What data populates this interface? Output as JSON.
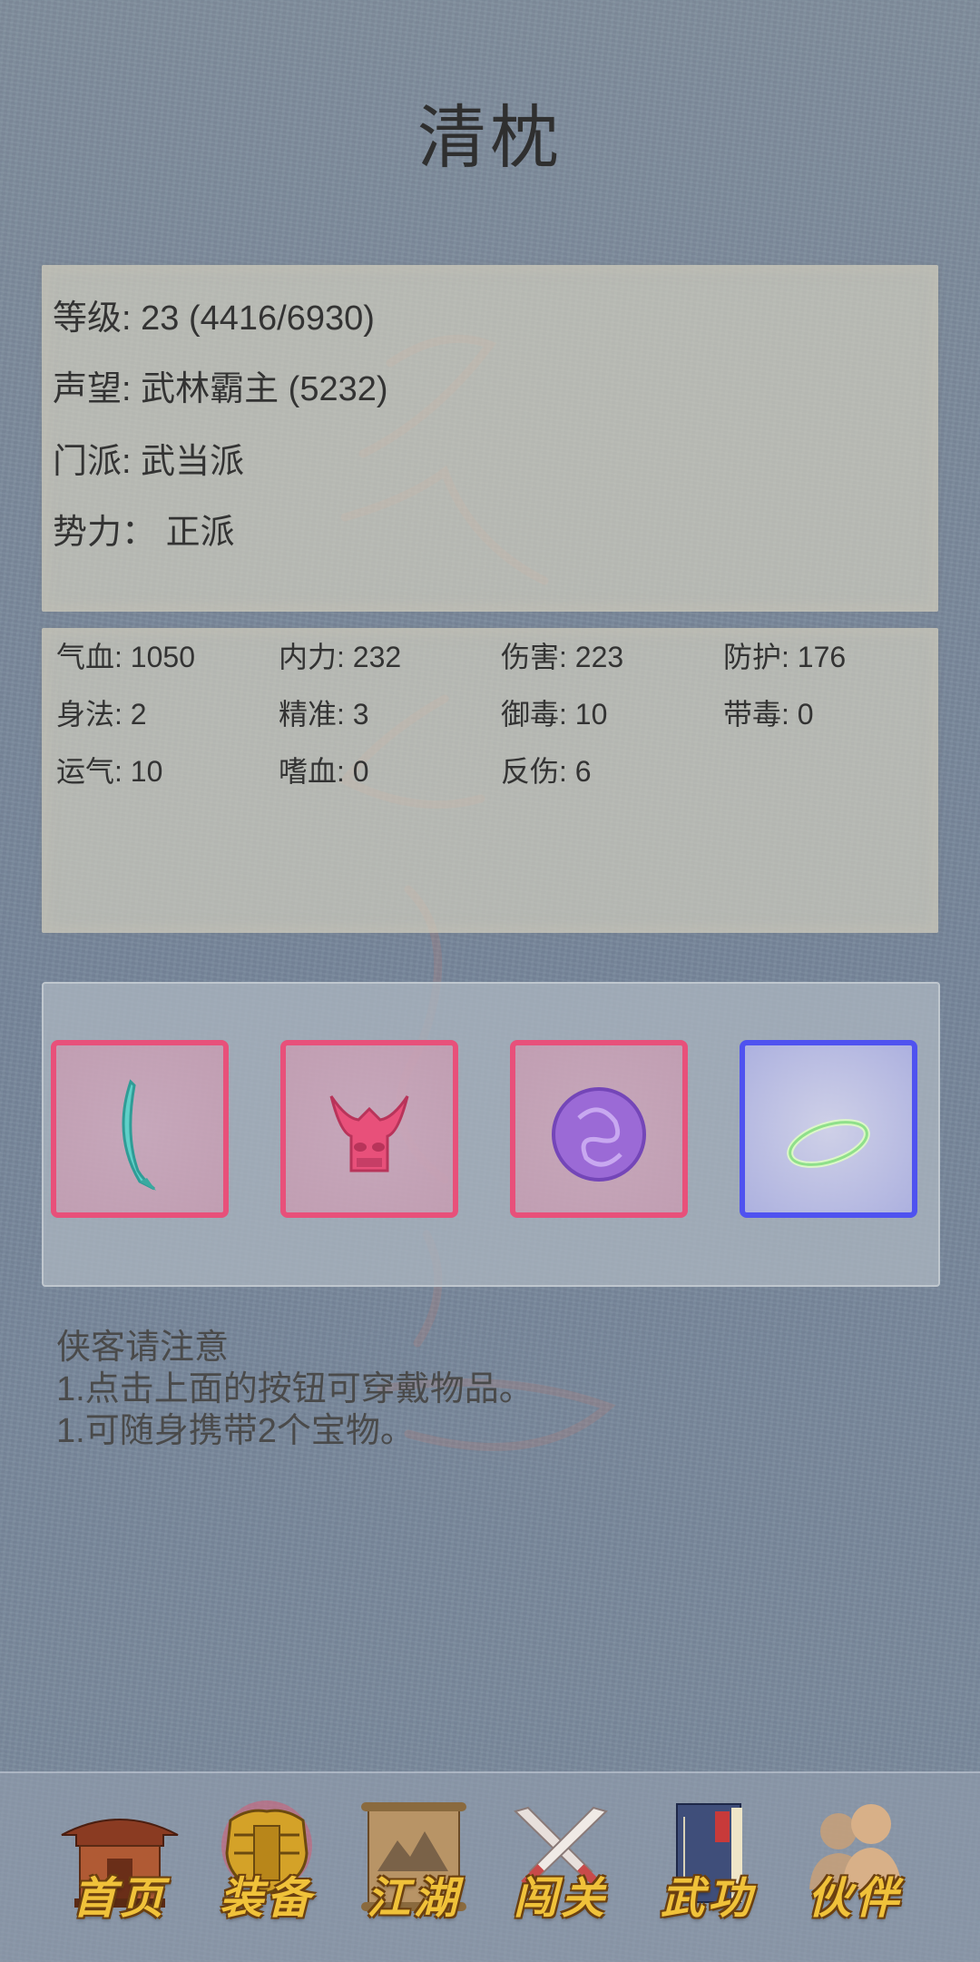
{
  "character_name": "清枕",
  "info": {
    "level": {
      "label": "等级:",
      "value": "23 (4416/6930)"
    },
    "fame": {
      "label": "声望:",
      "value": "武林霸主 (5232)"
    },
    "sect": {
      "label": "门派:",
      "value": "武当派"
    },
    "faction": {
      "label": "势力：",
      "value": "正派"
    }
  },
  "stats": [
    {
      "label": "气血:",
      "value": "1050"
    },
    {
      "label": "内力:",
      "value": "232"
    },
    {
      "label": "伤害:",
      "value": "223"
    },
    {
      "label": "防护:",
      "value": "176"
    },
    {
      "label": "身法:",
      "value": "2"
    },
    {
      "label": "精准:",
      "value": "3"
    },
    {
      "label": "御毒:",
      "value": "10"
    },
    {
      "label": "带毒:",
      "value": "0"
    },
    {
      "label": "运气:",
      "value": "10"
    },
    {
      "label": "嗜血:",
      "value": "0"
    },
    {
      "label": "反伤:",
      "value": "6"
    }
  ],
  "equipment_slots": [
    {
      "icon": "curved-blade-icon",
      "rarity_color": "#e8507a"
    },
    {
      "icon": "demon-mask-armor-icon",
      "rarity_color": "#e8507a"
    },
    {
      "icon": "purple-orb-icon",
      "rarity_color": "#e8507a"
    },
    {
      "icon": "jade-ring-icon",
      "rarity_color": "#4f52f0"
    }
  ],
  "notice": {
    "heading": "侠客请注意",
    "lines": [
      "1.点击上面的按钮可穿戴物品。",
      "1.可随身携带2个宝物。"
    ]
  },
  "nav": [
    {
      "label": "首页",
      "icon": "temple-gate-icon"
    },
    {
      "label": "装备",
      "icon": "golden-armor-icon",
      "active": true
    },
    {
      "label": "江湖",
      "icon": "scroll-map-icon"
    },
    {
      "label": "闯关",
      "icon": "crossed-swords-icon"
    },
    {
      "label": "武功",
      "icon": "martial-book-icon"
    },
    {
      "label": "伙伴",
      "icon": "companions-icon"
    }
  ]
}
